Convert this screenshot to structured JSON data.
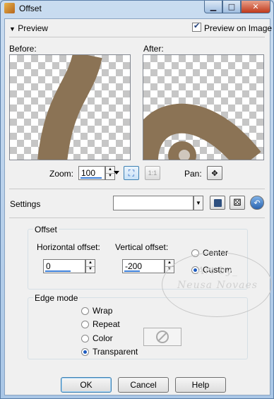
{
  "window": {
    "title": "Offset"
  },
  "preview": {
    "toggle_label": "Preview",
    "preview_on_image_label": "Preview on Image",
    "preview_on_image_checked": true,
    "before_label": "Before:",
    "after_label": "After:",
    "object_color": "#8b7355"
  },
  "zoom": {
    "label": "Zoom:",
    "value": "100",
    "actual_size_label": "1:1",
    "pan_label": "Pan:"
  },
  "settings": {
    "label": "Settings",
    "value": ""
  },
  "offset": {
    "group_label": "Offset",
    "horizontal_label": "Horizontal offset:",
    "horizontal_value": "0",
    "vertical_label": "Vertical offset:",
    "vertical_value": "-200",
    "options": [
      "Center",
      "Custom"
    ],
    "selected": "Custom"
  },
  "edge_mode": {
    "group_label": "Edge mode",
    "options": [
      "Wrap",
      "Repeat",
      "Color",
      "Transparent"
    ],
    "selected": "Transparent"
  },
  "watermark": {
    "line1": "Art by_",
    "line2": "Neusa Novaes"
  },
  "buttons": {
    "ok": "OK",
    "cancel": "Cancel",
    "help": "Help"
  }
}
